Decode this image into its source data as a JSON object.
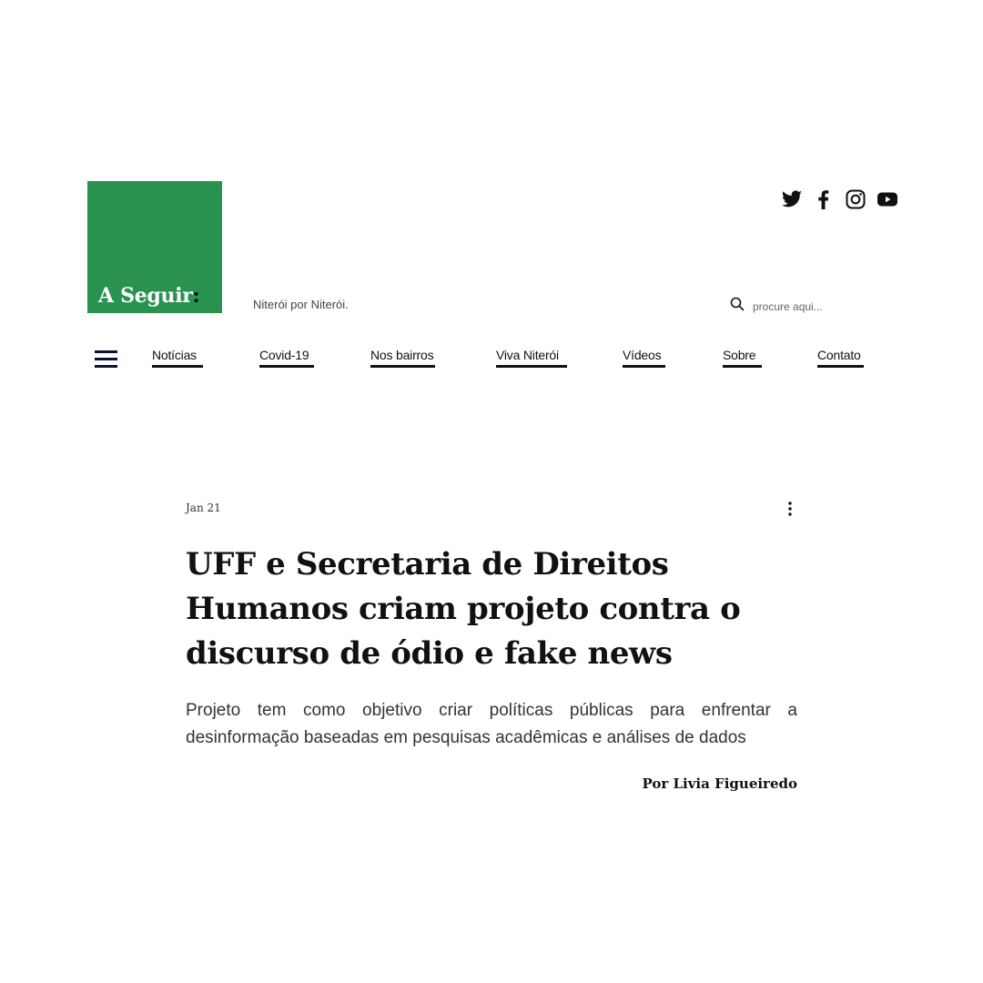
{
  "brand": {
    "logo_text": "A Seguir",
    "logo_colon": ":",
    "tagline": "Niterói por Niterói.",
    "logo_color": "#29924f"
  },
  "social": [
    {
      "icon": "twitter-icon"
    },
    {
      "icon": "facebook-icon"
    },
    {
      "icon": "instagram-icon"
    },
    {
      "icon": "youtube-icon"
    }
  ],
  "search": {
    "placeholder": "procure aqui..."
  },
  "nav": {
    "menu_icon": "hamburger-icon",
    "items": [
      {
        "label": "Notícias"
      },
      {
        "label": "Covid-19"
      },
      {
        "label": "Nos bairros"
      },
      {
        "label": "Viva Niterói"
      },
      {
        "label": "Vídeos"
      },
      {
        "label": "Sobre"
      },
      {
        "label": "Contato"
      }
    ]
  },
  "article": {
    "date": "Jan 21",
    "title": "UFF e Secretaria de Direitos Humanos criam projeto contra o discurso de ódio e fake news",
    "subtitle": "Projeto tem como objetivo criar políticas públicas para enfrentar a desinformação baseadas em pesquisas acadêmicas e análises de dados",
    "byline": "Por Livia Figueiredo"
  }
}
